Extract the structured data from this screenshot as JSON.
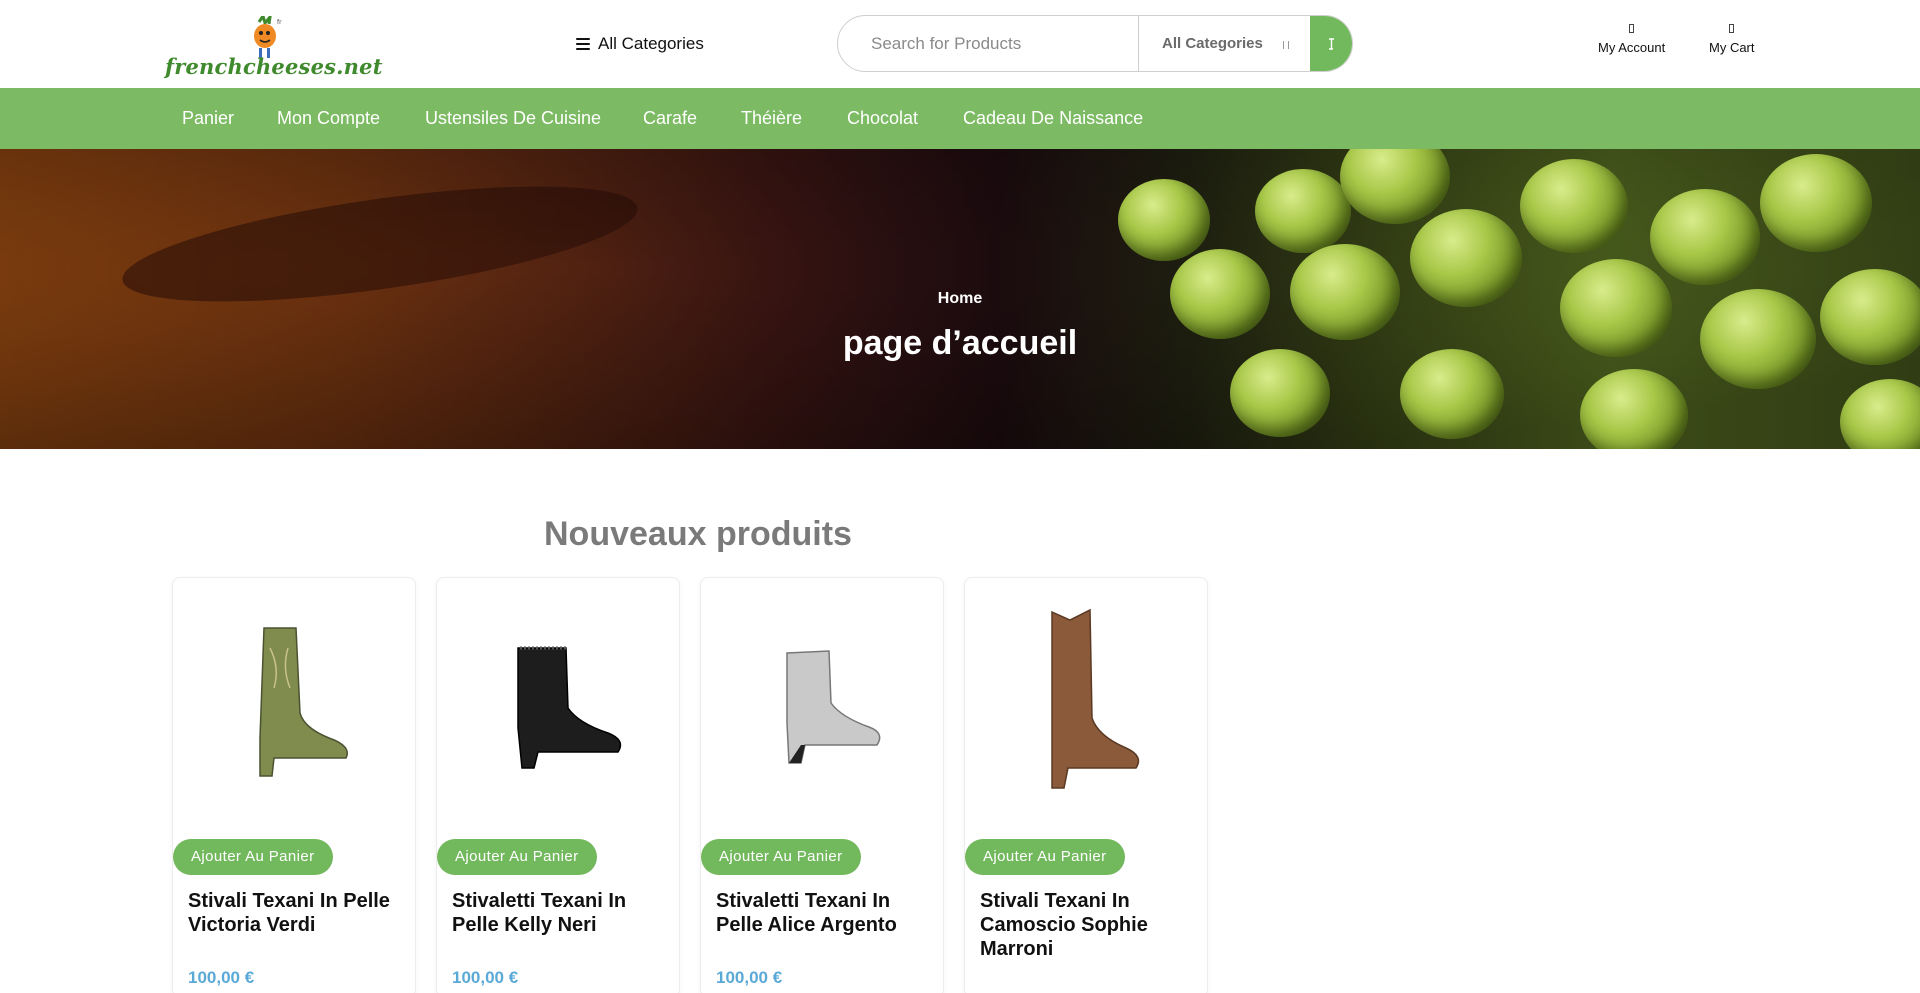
{
  "header": {
    "logo_text": "frenchcheeses.net",
    "categories_toggle_label": "All Categories",
    "search": {
      "placeholder": "Search for Products",
      "category_selected": "All Categories"
    },
    "account_label": "My Account",
    "cart_label": "My Cart"
  },
  "nav": {
    "items": [
      {
        "label": "Panier"
      },
      {
        "label": "Mon Compte"
      },
      {
        "label": "Ustensiles De Cuisine"
      },
      {
        "label": "Carafe"
      },
      {
        "label": "Théière"
      },
      {
        "label": "Chocolat"
      },
      {
        "label": "Cadeau De Naissance"
      }
    ]
  },
  "hero": {
    "breadcrumb": "Home",
    "title": "page d’accueil"
  },
  "products_section": {
    "title": "Nouveaux produits",
    "add_label": "Ajouter Au Panier",
    "items": [
      {
        "name": "Stivali Texani In Pelle Victoria Verdi",
        "price": "100,00 €",
        "boot_color": "#7f8c4e"
      },
      {
        "name": "Stivaletti Texani In Pelle Kelly Neri",
        "price": "100,00 €",
        "boot_color": "#1d1d1d"
      },
      {
        "name": "Stivaletti Texani In Pelle Alice Argento",
        "price": "100,00 €",
        "boot_color": "#c9c9c9"
      },
      {
        "name": "Stivali Texani In Camoscio Sophie Marroni",
        "price": "",
        "boot_color": "#8a5a3a"
      }
    ]
  },
  "colors": {
    "brand_green": "#7cbb63",
    "button_green": "#72b85d",
    "price_blue": "#5aa9d6"
  }
}
